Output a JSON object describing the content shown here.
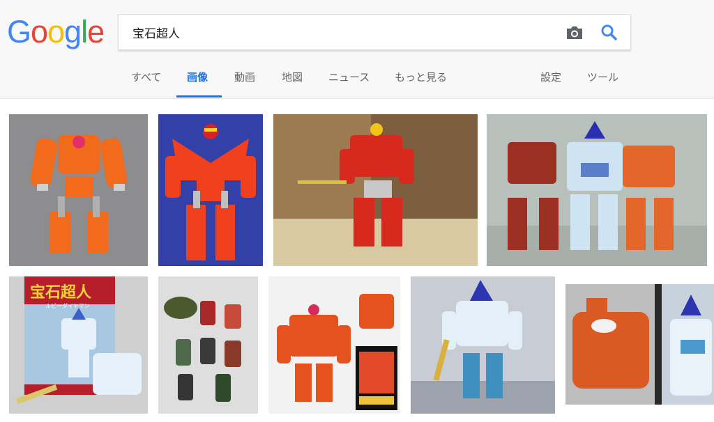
{
  "logo": {
    "letters": [
      "G",
      "o",
      "o",
      "g",
      "l",
      "e"
    ]
  },
  "search": {
    "query": "宝石超人"
  },
  "nav": {
    "tabs": [
      "すべて",
      "画像",
      "動画",
      "地図",
      "ニュース",
      "もっと見る"
    ],
    "settings": "設定",
    "tools": "ツール",
    "active_tab": "画像"
  },
  "thumbs_box_title": "宝石超人",
  "thumbs_box_subtitle": "ルビーダイヤマン",
  "colors": {
    "blue": "#4285f4",
    "red": "#ea4335",
    "yellow": "#fbbc05",
    "green": "#34a853",
    "active_tab": "#1a73e8"
  },
  "icons": [
    "camera-icon",
    "search-icon"
  ]
}
